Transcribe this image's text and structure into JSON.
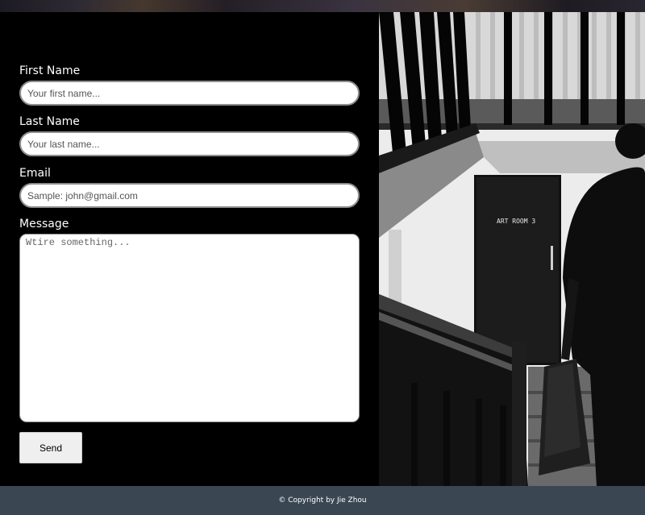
{
  "form": {
    "first_name": {
      "label": "First Name",
      "placeholder": "Your first name...",
      "value": ""
    },
    "last_name": {
      "label": "Last Name",
      "placeholder": "Your last name...",
      "value": ""
    },
    "email": {
      "label": "Email",
      "placeholder": "Sample: john@gmail.com",
      "value": ""
    },
    "message": {
      "label": "Message",
      "placeholder": "Wtire something...",
      "value": ""
    },
    "send_label": "Send"
  },
  "photo": {
    "door_sign": "ART ROOM 3"
  },
  "footer": {
    "copyright": "© Copyright by Jie Zhou"
  }
}
